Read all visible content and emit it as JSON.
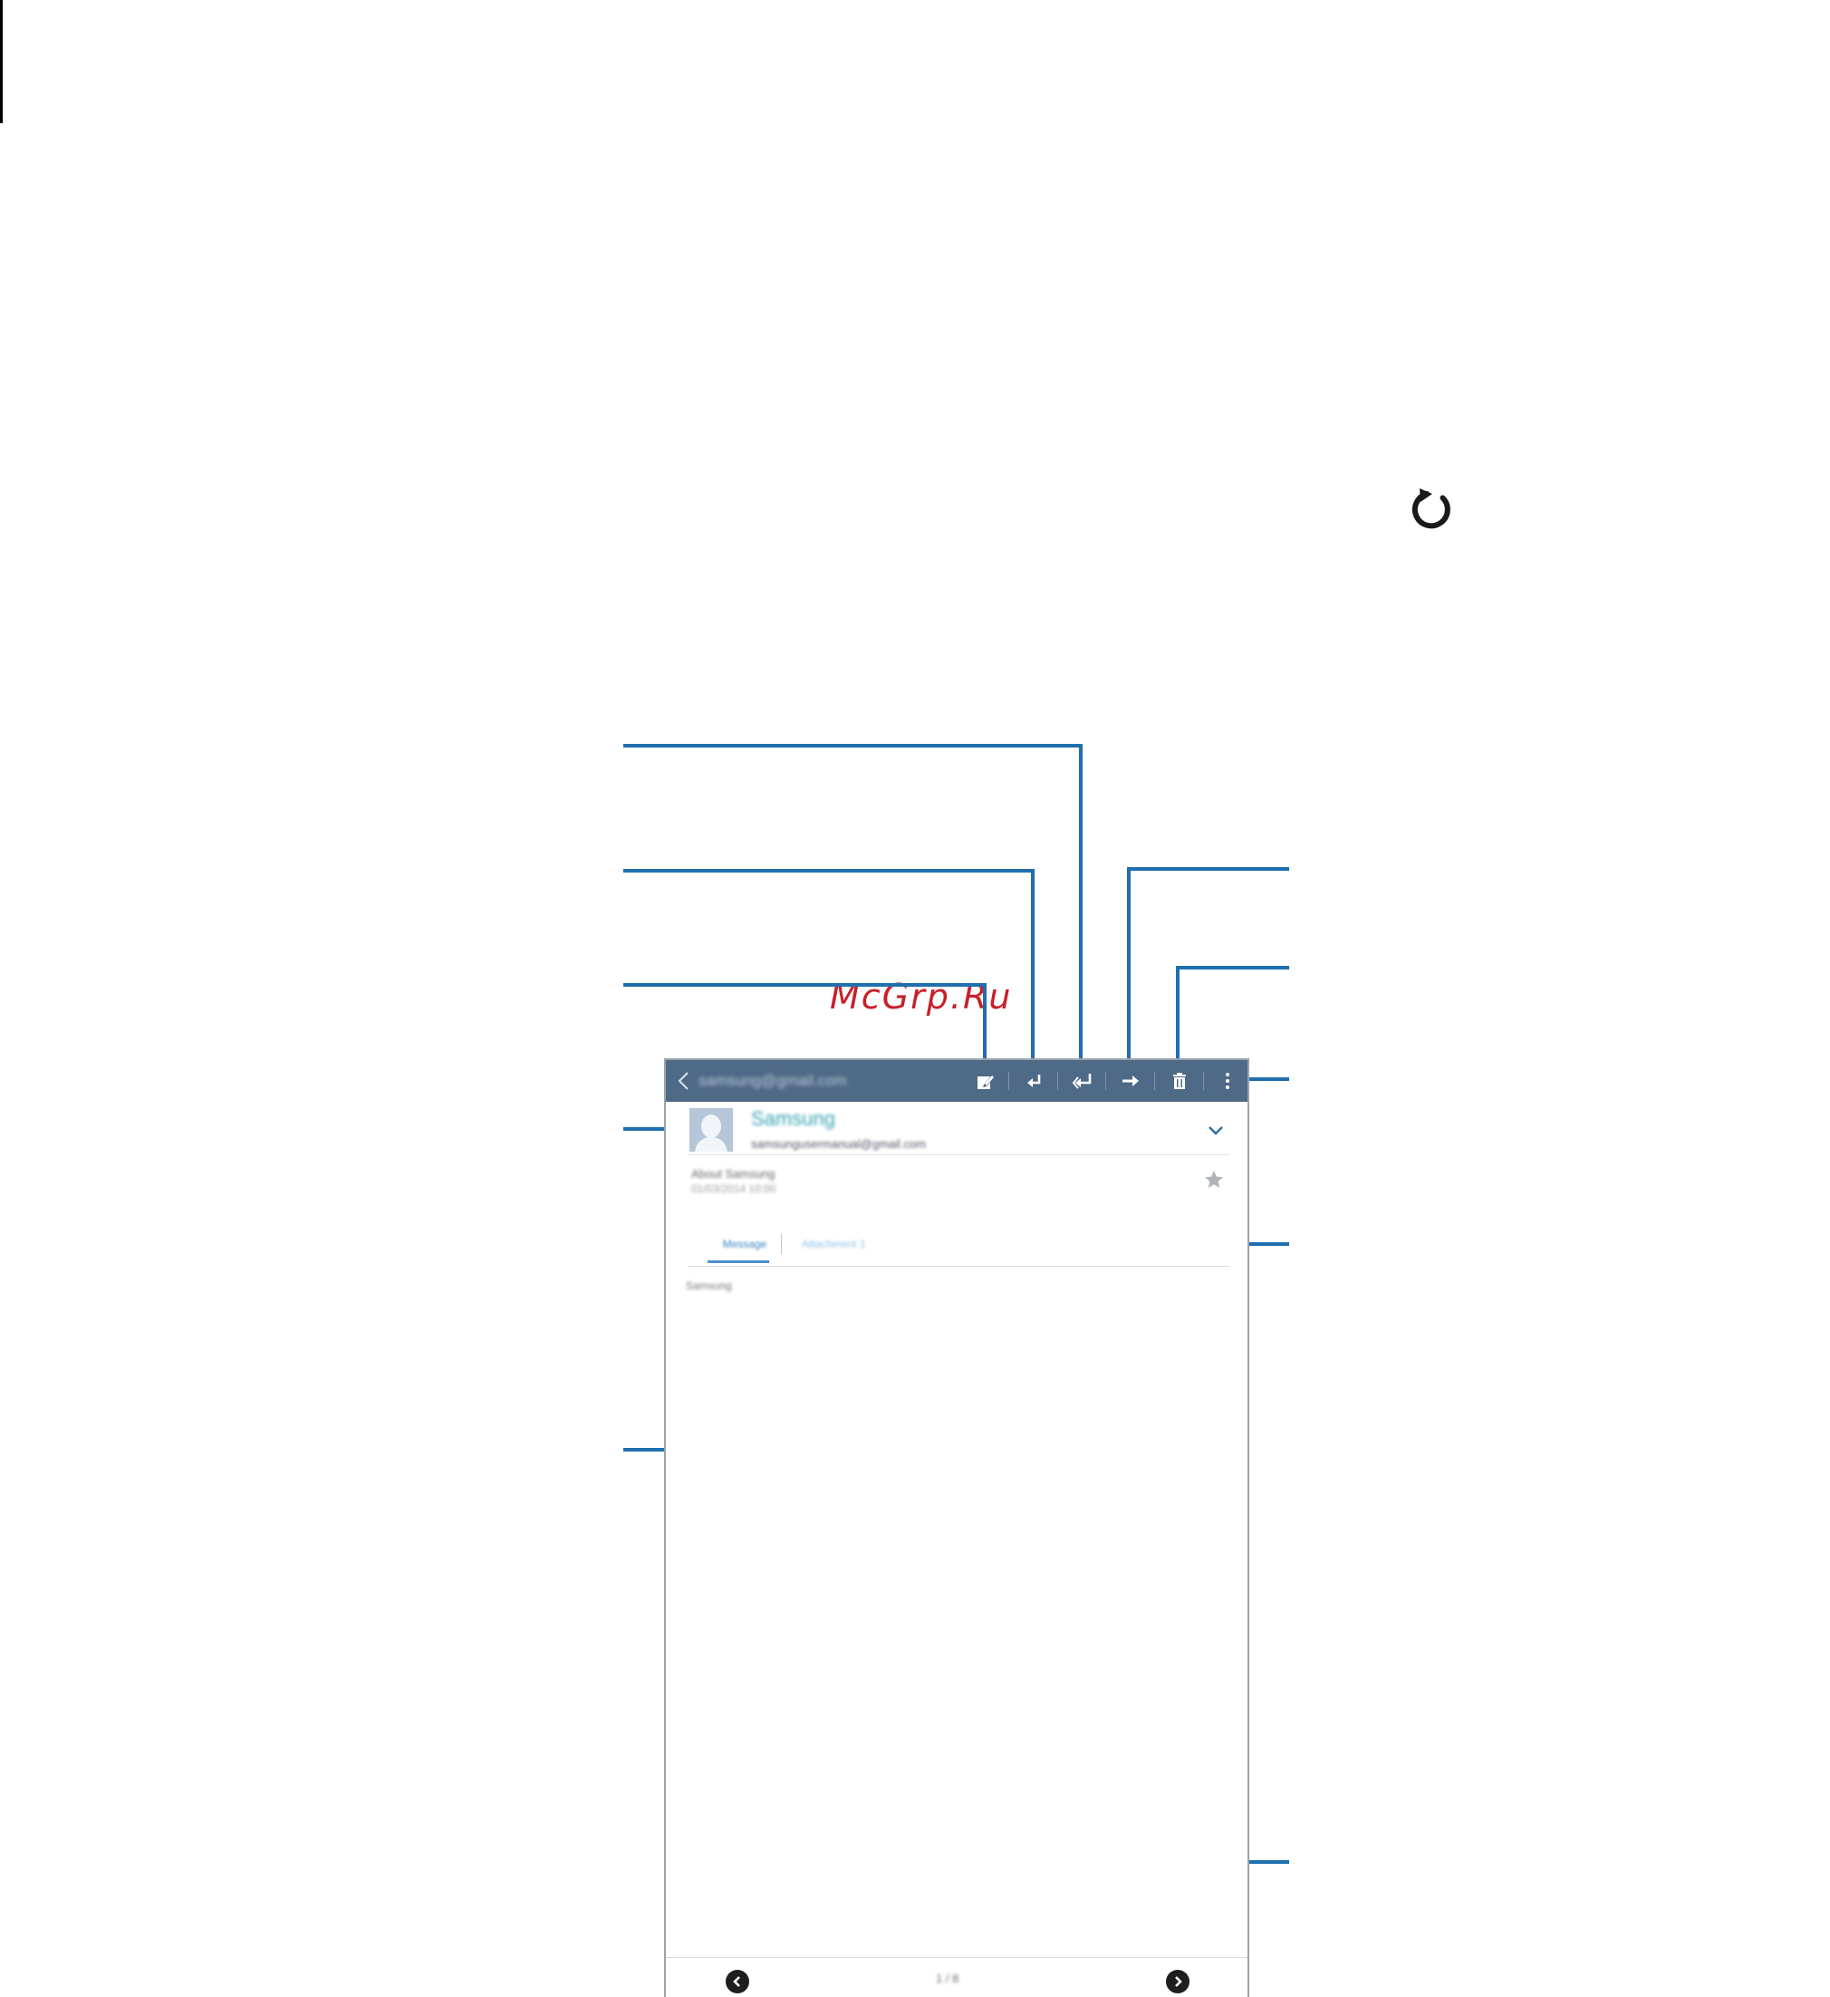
{
  "watermark": "McGrp.Ru",
  "colors": {
    "action_bar": "#4f6a87",
    "callout_line": "#1f6fae",
    "sender_name": "#37a3b3",
    "tab_active": "#4a8ed0",
    "watermark": "#c8202a"
  },
  "icons": [
    "refresh-icon",
    "back-icon",
    "compose-icon",
    "reply-icon",
    "reply-all-icon",
    "forward-icon",
    "delete-icon",
    "more-options-icon",
    "expand-icon",
    "star-icon",
    "previous-icon",
    "next-icon"
  ],
  "email_app": {
    "action_bar": {
      "account": "samsung@gmail.com"
    },
    "sender": {
      "name": "Samsung",
      "email": "samsungusermanual@gmail.com"
    },
    "message": {
      "subject": "About Samsung",
      "datetime": "01/03/2014 10:00",
      "body": "Samsung"
    },
    "tabs": {
      "message": "Message",
      "attachment": "Attachment 1"
    },
    "footer": {
      "page_counter": "1 / 8"
    }
  }
}
